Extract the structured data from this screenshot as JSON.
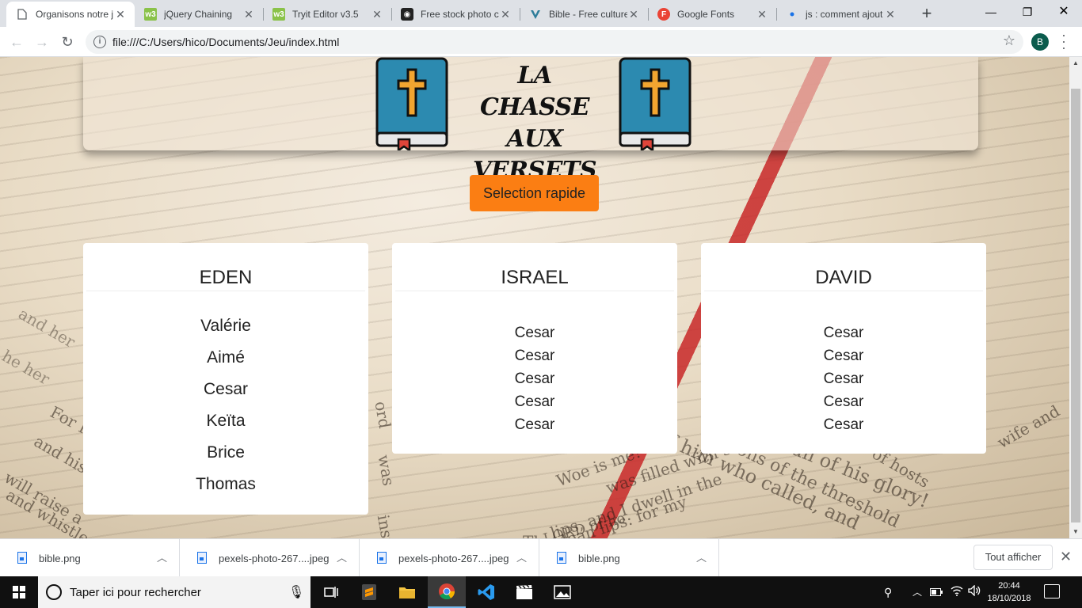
{
  "browser": {
    "tabs": [
      {
        "title": "Organisons notre j",
        "active": true
      },
      {
        "title": "jQuery Chaining",
        "active": false
      },
      {
        "title": "Tryit Editor v3.5",
        "active": false
      },
      {
        "title": "Free stock photo c",
        "active": false
      },
      {
        "title": "Bible - Free culture",
        "active": false
      },
      {
        "title": "Google Fonts",
        "active": false
      },
      {
        "title": "js : comment ajout",
        "active": false
      }
    ],
    "url": "file:///C:/Users/hico/Documents/Jeu/index.html",
    "profile_initial": "B"
  },
  "page": {
    "title_line1": "LA CHASSE",
    "title_line2": "AUX",
    "title_line3": "VERSETS",
    "quick_button": "Selection rapide",
    "teams": [
      {
        "name": "EDEN",
        "members": [
          "Valérie",
          "Aimé",
          "Cesar",
          "Keïta",
          "Brice",
          "Thomas"
        ]
      },
      {
        "name": "ISRAEL",
        "members": [
          "Cesar",
          "Cesar",
          "Cesar",
          "Cesar",
          "Cesar"
        ]
      },
      {
        "name": "DAVID",
        "members": [
          "Cesar",
          "Cesar",
          "Cesar",
          "Cesar",
          "Cesar"
        ]
      }
    ],
    "bg_text": [
      "For I am",
      "Woe is me!",
      "lips, and I dwell in the",
      "unclean lips: for my",
      "the LORD of ho",
      "The",
      "was filled with smoke.",
      "of him who called, and",
      "full of his glory!",
      "LORD of hosts",
      "dations of the threshold",
      "will raise a",
      "and whistle fo",
      "and his",
      "and her",
      "he her",
      "wife and",
      "ord",
      "was",
      "inst"
    ]
  },
  "downloads": {
    "items": [
      "bible.png",
      "pexels-photo-267....jpeg",
      "pexels-photo-267....jpeg",
      "bible.png"
    ],
    "show_all": "Tout afficher"
  },
  "taskbar": {
    "search_placeholder": "Taper ici pour rechercher",
    "time": "20:44",
    "date": "18/10/2018"
  }
}
